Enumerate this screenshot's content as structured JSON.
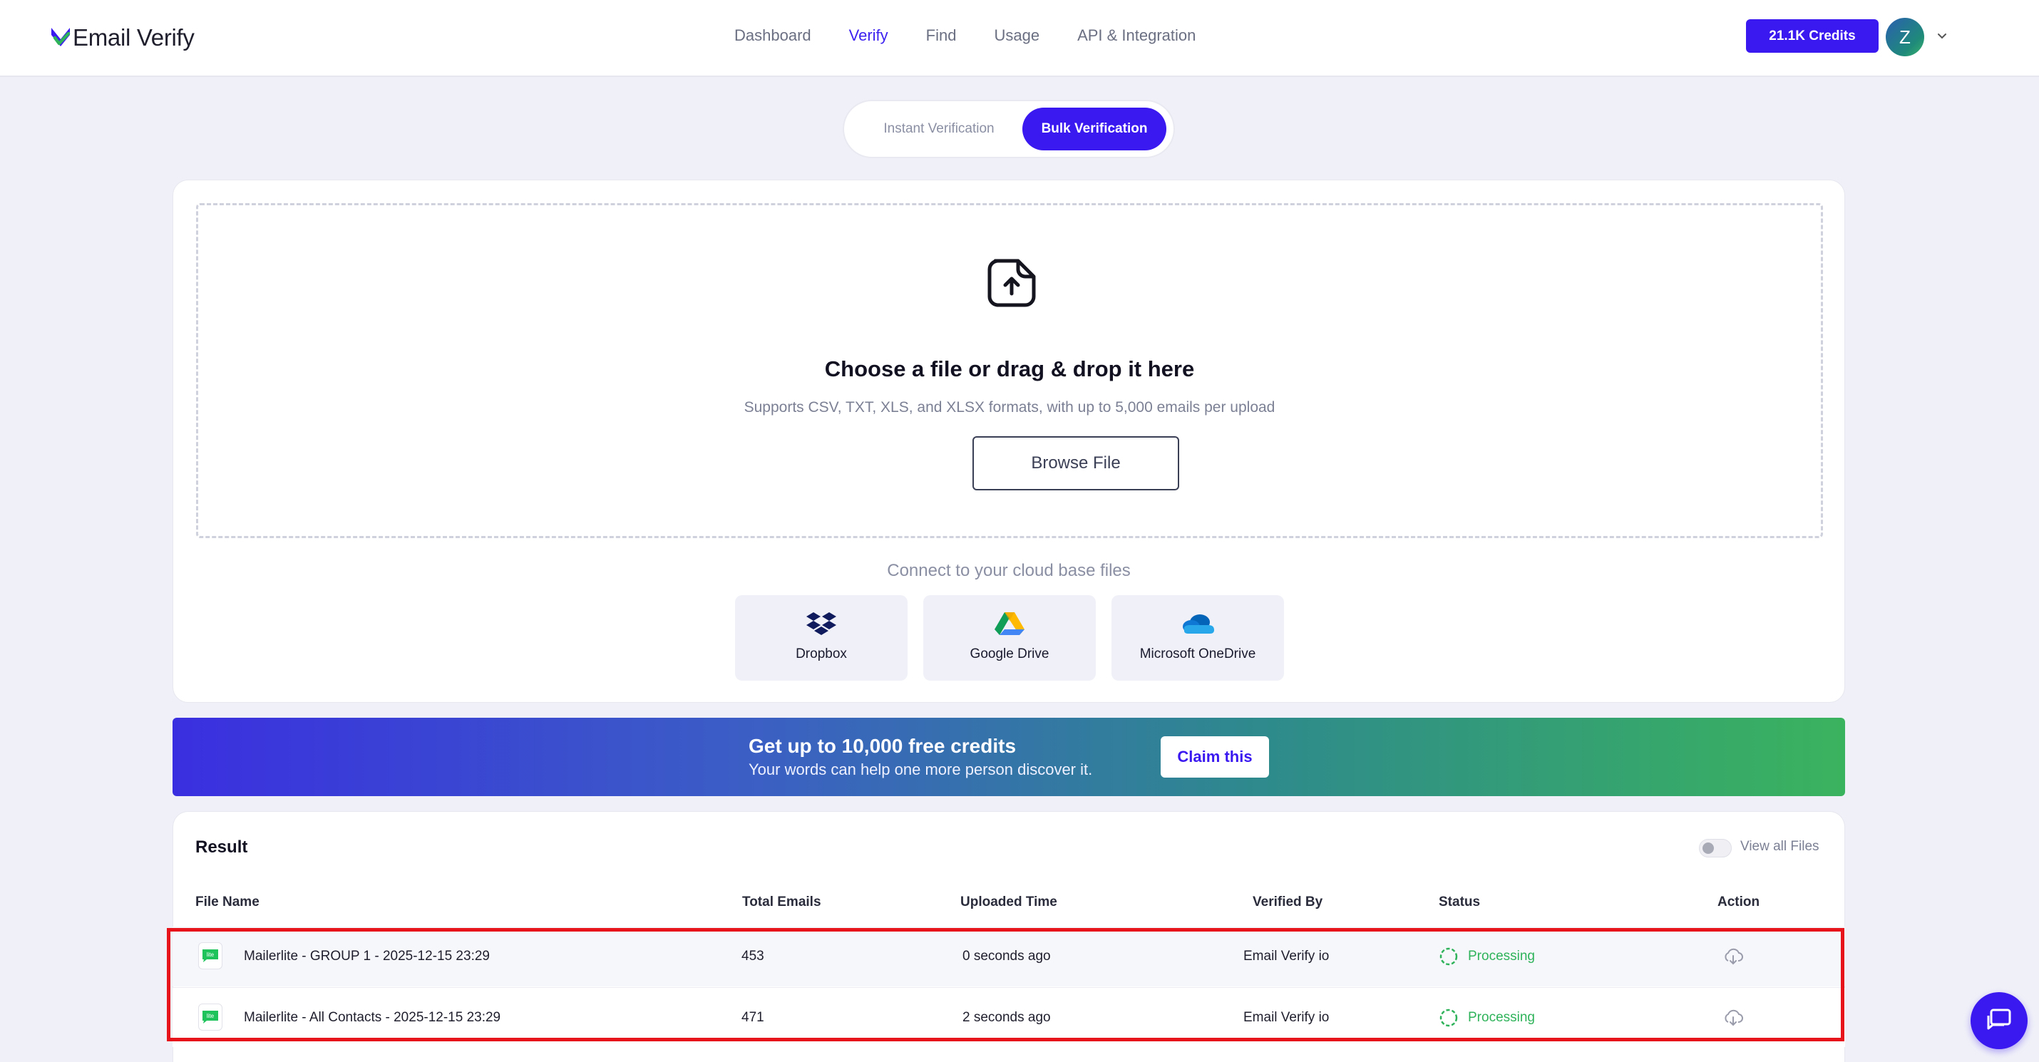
{
  "app": {
    "logo_text": "Email Verify",
    "accent_color": "#3a18f0"
  },
  "nav": {
    "items": [
      {
        "label": "Dashboard"
      },
      {
        "label": "Verify",
        "active": true
      },
      {
        "label": "Find"
      },
      {
        "label": "Usage"
      },
      {
        "label": "API & Integration"
      }
    ]
  },
  "header": {
    "credits_label": "21.1K Credits",
    "avatar_initial": "Z"
  },
  "tabs": {
    "instant": "Instant Verification",
    "bulk": "Bulk Verification",
    "active": "bulk"
  },
  "upload": {
    "title": "Choose a file or drag & drop it here",
    "subtitle": "Supports CSV, TXT, XLS, and XLSX formats, with up to 5,000 emails per upload",
    "browse_label": "Browse File",
    "cloud_caption": "Connect to your cloud base files",
    "cloud_sources": [
      {
        "label": "Dropbox",
        "icon": "dropbox-icon"
      },
      {
        "label": "Google Drive",
        "icon": "google-drive-icon"
      },
      {
        "label": "Microsoft OneDrive",
        "icon": "onedrive-icon"
      }
    ]
  },
  "promo": {
    "title": "Get up to 10,000 free credits",
    "subtitle": "Your words can help one more person discover it.",
    "cta": "Claim this"
  },
  "result": {
    "title": "Result",
    "view_all_label": "View all Files",
    "view_all_enabled": false,
    "columns": [
      "File Name",
      "Total Emails",
      "Uploaded Time",
      "Verified By",
      "Status",
      "Action"
    ],
    "rows": [
      {
        "file_name": "Mailerlite - GROUP 1 - 2025-12-15 23:29",
        "total_emails": "453",
        "uploaded_time": "0 seconds ago",
        "verified_by": "Email Verify io",
        "status": "Processing",
        "source_badge": "lite"
      },
      {
        "file_name": "Mailerlite - All Contacts - 2025-12-15 23:29",
        "total_emails": "471",
        "uploaded_time": "2 seconds ago",
        "verified_by": "Email Verify io",
        "status": "Processing",
        "source_badge": "lite"
      }
    ]
  }
}
